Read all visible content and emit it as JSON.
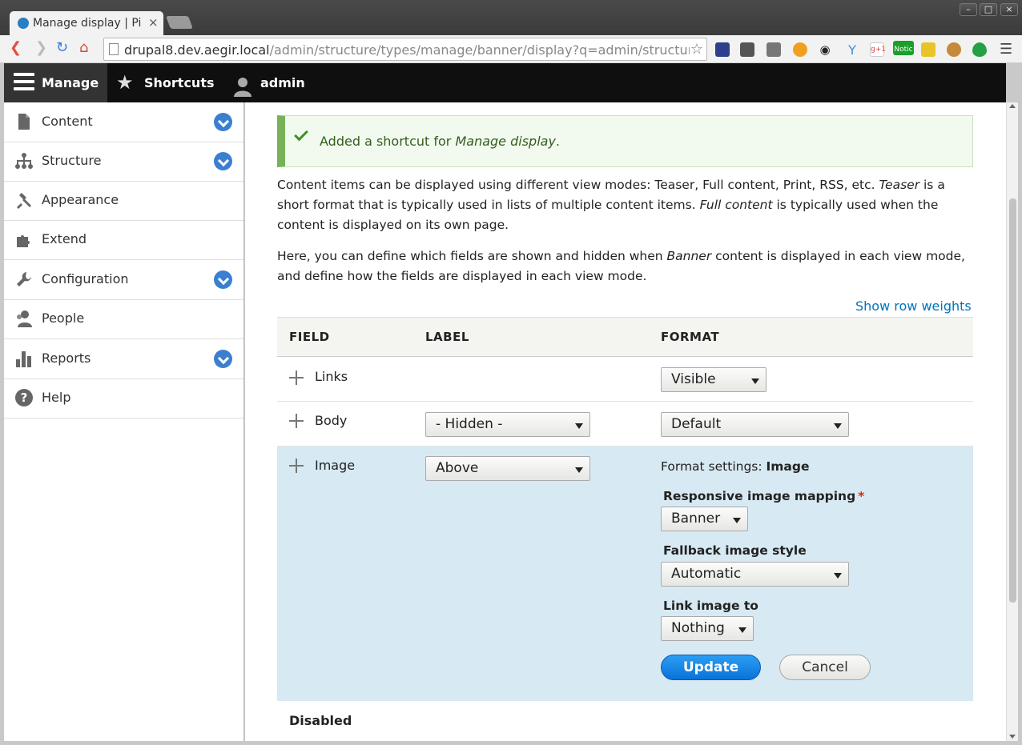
{
  "browser": {
    "tab_title": "Manage display | Pictu",
    "url_host": "drupal8.dev.aegir.local",
    "url_path": "/admin/structure/types/manage/banner/display?q=admin/structure/types/ma",
    "extension_badge": "Notic",
    "extension_gplus": "g+1"
  },
  "admin_toolbar": {
    "manage": "Manage",
    "shortcuts": "Shortcuts",
    "user": "admin"
  },
  "sidebar": {
    "items": [
      {
        "label": "Content",
        "icon": "content-icon",
        "expandable": true
      },
      {
        "label": "Structure",
        "icon": "structure-icon",
        "expandable": true
      },
      {
        "label": "Appearance",
        "icon": "appearance-icon",
        "expandable": false
      },
      {
        "label": "Extend",
        "icon": "extend-icon",
        "expandable": false
      },
      {
        "label": "Configuration",
        "icon": "wrench-icon",
        "expandable": true
      },
      {
        "label": "People",
        "icon": "people-icon",
        "expandable": false
      },
      {
        "label": "Reports",
        "icon": "reports-icon",
        "expandable": true
      },
      {
        "label": "Help",
        "icon": "help-icon",
        "expandable": false
      }
    ]
  },
  "message": {
    "prefix": "Added a shortcut for ",
    "emphasis": "Manage display",
    "suffix": "."
  },
  "intro": {
    "p1_a": "Content items can be displayed using different view modes: Teaser, Full content, Print, RSS, etc. ",
    "p1_b": "Teaser",
    "p1_c": " is a short format that is typically used in lists of multiple content items. ",
    "p1_d": "Full content",
    "p1_e": " is typically used when the content is displayed on its own page.",
    "p2_a": "Here, you can define which fields are shown and hidden when ",
    "p2_b": "Banner",
    "p2_c": " content is displayed in each view mode, and define how the fields are displayed in each view mode."
  },
  "show_row_weights": "Show row weights",
  "table": {
    "headers": {
      "field": "FIELD",
      "label": "LABEL",
      "format": "FORMAT"
    },
    "rows": [
      {
        "field": "Links",
        "label": "",
        "format": "Visible"
      },
      {
        "field": "Body",
        "label": "- Hidden -",
        "format": "Default"
      },
      {
        "field": "Image",
        "label": "Above",
        "format": ""
      }
    ],
    "format_settings": {
      "heading_prefix": "Format settings: ",
      "heading_field": "Image",
      "responsive_label": "Responsive image mapping",
      "required_mark": "*",
      "responsive_value": "Banner",
      "fallback_label": "Fallback image style",
      "fallback_value": "Automatic",
      "link_label": "Link image to",
      "link_value": "Nothing",
      "update": "Update",
      "cancel": "Cancel"
    },
    "disabled_label": "Disabled"
  },
  "colors": {
    "accent": "#0074bd",
    "status_green": "#77b259",
    "highlight_row": "#d7e9f2",
    "admin_bar": "#0f0f0f"
  }
}
